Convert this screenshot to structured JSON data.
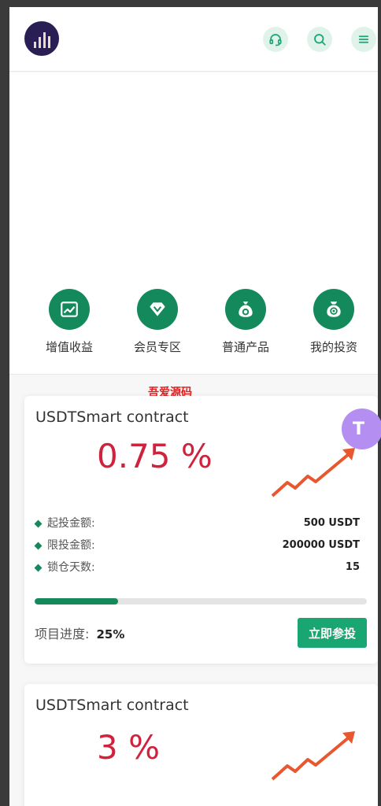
{
  "header": {
    "logo_name": "logo",
    "icons": [
      "headset-icon",
      "search-icon",
      "menu-icon"
    ]
  },
  "nav": {
    "items": [
      {
        "label": "增值收益",
        "icon": "chart-icon"
      },
      {
        "label": "会员专区",
        "icon": "diamond-icon"
      },
      {
        "label": "普通产品",
        "icon": "money-bag-icon"
      },
      {
        "label": "我的投资",
        "icon": "coin-bag-icon"
      }
    ]
  },
  "watermark": "吾爱源码",
  "floating_button": {
    "glyph": "T"
  },
  "products": [
    {
      "title": "USDTSmart contract",
      "rate": "0.75 %",
      "details": [
        {
          "key": "起投金额:",
          "value": "500 USDT"
        },
        {
          "key": "限投金额:",
          "value": "200000 USDT"
        },
        {
          "key": "锁仓天数:",
          "value": "15"
        }
      ],
      "progress_label": "项目进度:",
      "progress_value": "25%",
      "progress_fraction": 0.25,
      "button_label": "立即参投"
    },
    {
      "title": "USDTSmart contract",
      "rate": "3 %"
    }
  ],
  "colors": {
    "primary_green": "#148a5c",
    "button_green": "#1aa672",
    "rate_red": "#d0223c",
    "trend_orange": "#e8572e"
  }
}
